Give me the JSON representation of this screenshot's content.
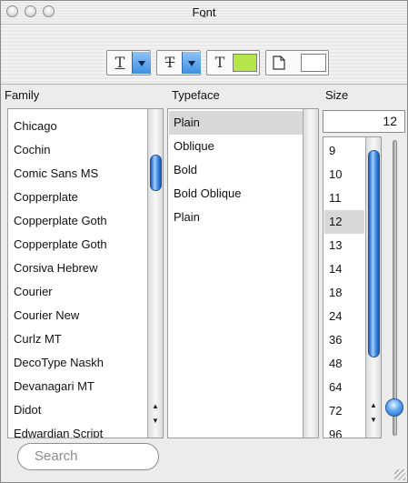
{
  "window": {
    "title": "Font",
    "toolbar_toggle_glyph": "⌃"
  },
  "toolbar": {
    "underline_glyph": "T",
    "strike_glyph": "T",
    "text_color_glyph": "T",
    "text_color": "#b4e64a",
    "doc_color": "#ffffff",
    "dropdown_color": "#3d8fe5"
  },
  "family": {
    "header": "Family",
    "items": [
      "Chicago",
      "Cochin",
      "Comic Sans MS",
      "Copperplate",
      "Copperplate Goth",
      "Copperplate Goth",
      "Corsiva Hebrew",
      "Courier",
      "Courier New",
      "Curlz MT",
      "DecoType Naskh",
      "Devanagari MT",
      "Didot",
      "Edwardian Script"
    ]
  },
  "typeface": {
    "header": "Typeface",
    "items": [
      "Plain",
      "Oblique",
      "Bold",
      "Bold Oblique",
      "Plain"
    ],
    "selected": 0
  },
  "size": {
    "header": "Size",
    "value": "12",
    "items": [
      "9",
      "10",
      "11",
      "12",
      "13",
      "14",
      "18",
      "24",
      "36",
      "48",
      "64",
      "72",
      "96"
    ],
    "selected": 3
  },
  "search": {
    "placeholder": "Search"
  }
}
